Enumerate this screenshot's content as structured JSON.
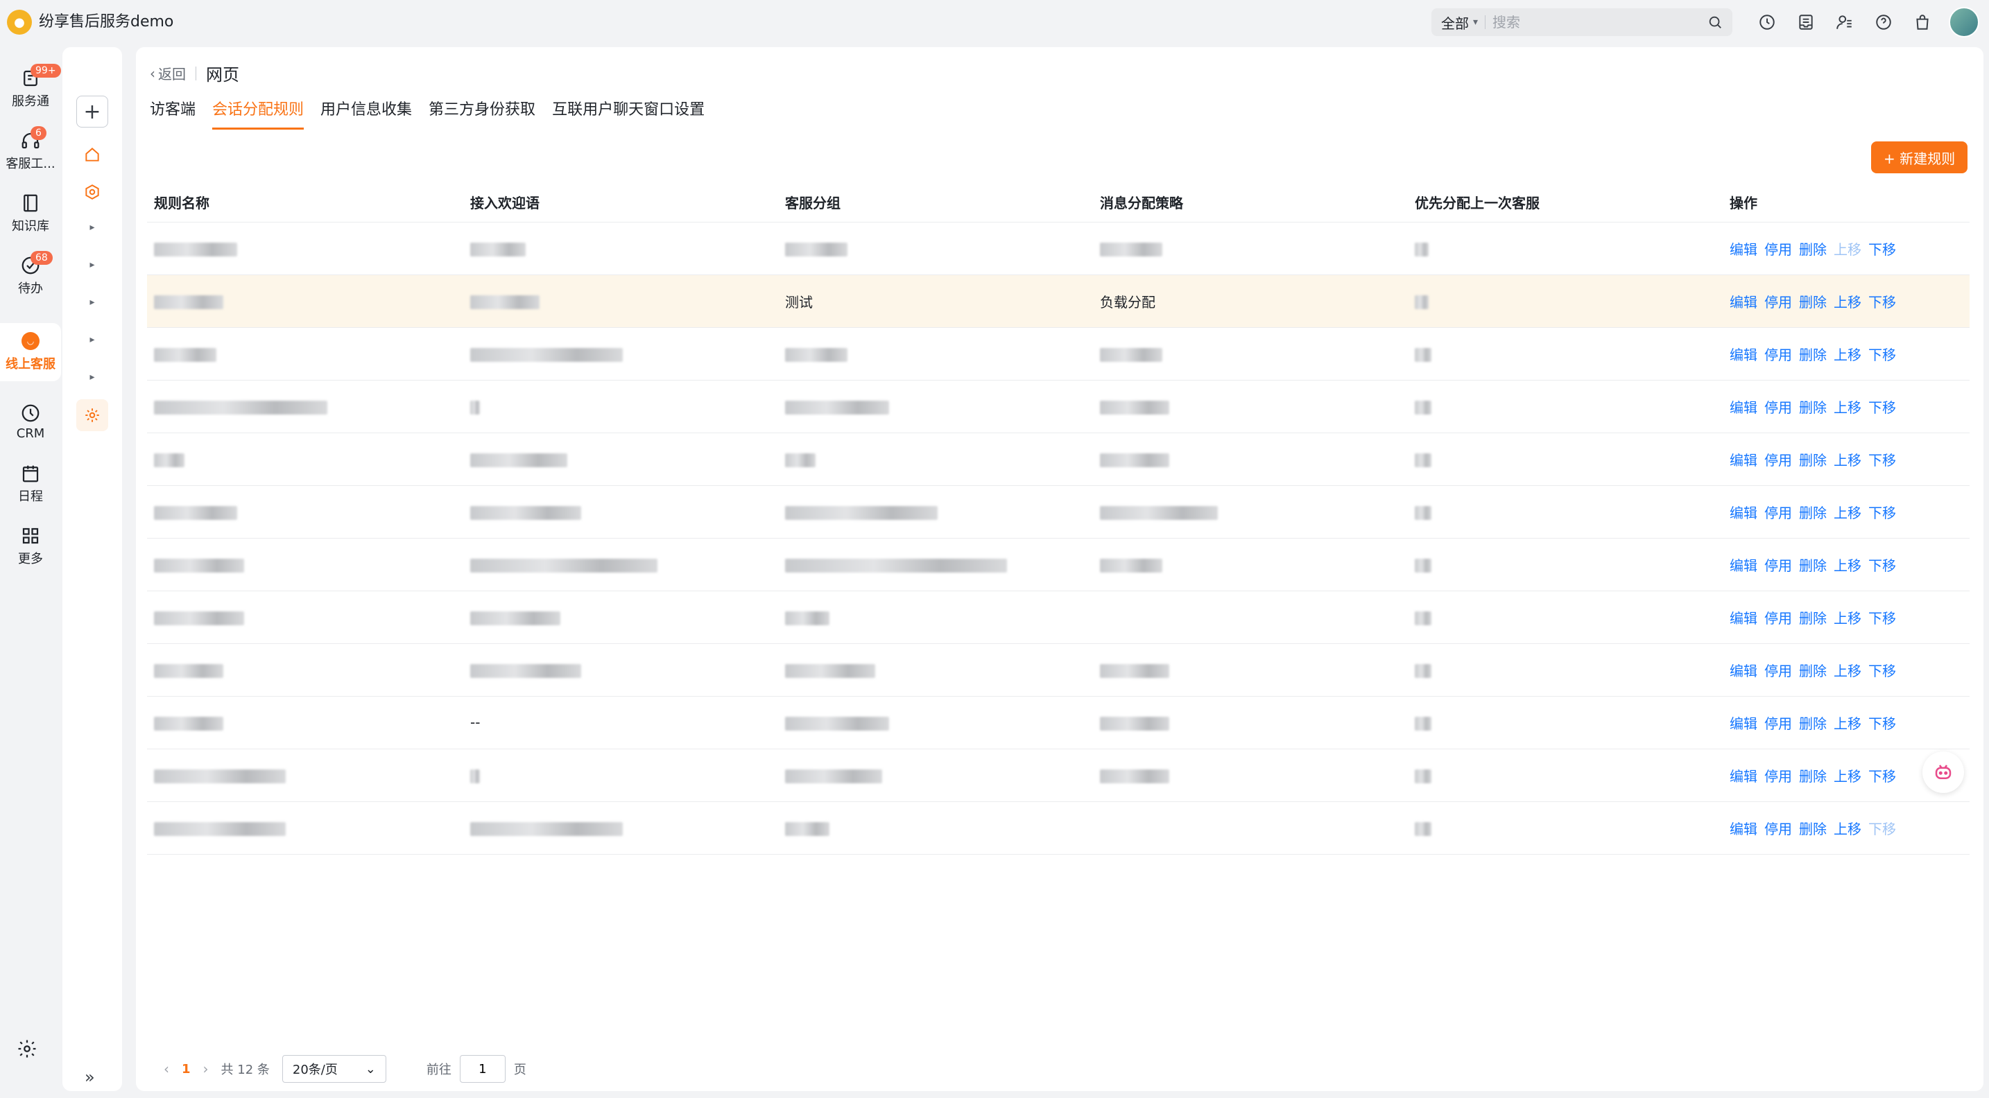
{
  "app": {
    "title": "纷享售后服务demo",
    "logo_icon": "bee-logo-icon"
  },
  "search": {
    "scope": "全部",
    "placeholder": "搜索"
  },
  "top_icons": [
    "clock-icon",
    "inbox-icon",
    "user-settings-icon",
    "help-icon",
    "bag-icon"
  ],
  "leftnav": [
    {
      "label": "服务通",
      "badge": "99+",
      "icon": "service-icon"
    },
    {
      "label": "客服工...",
      "badge": "6",
      "icon": "headset-icon"
    },
    {
      "label": "知识库",
      "badge": "",
      "icon": "book-icon"
    },
    {
      "label": "待办",
      "badge": "68",
      "icon": "check-icon"
    },
    {
      "label": "线上客服",
      "badge": "",
      "icon": "chat-icon",
      "active": true
    },
    {
      "label": "CRM",
      "badge": "",
      "icon": "crm-icon"
    },
    {
      "label": "日程",
      "badge": "",
      "icon": "calendar-icon"
    },
    {
      "label": "更多",
      "badge": "",
      "icon": "grid-icon"
    }
  ],
  "main": {
    "back_label": "返回",
    "page_title": "网页",
    "tabs": [
      {
        "label": "访客端",
        "active": false
      },
      {
        "label": "会话分配规则",
        "active": true
      },
      {
        "label": "用户信息收集",
        "active": false
      },
      {
        "label": "第三方身份获取",
        "active": false
      },
      {
        "label": "互联用户聊天窗口设置",
        "active": false
      }
    ],
    "new_rule_label": "+ 新建规则",
    "columns": [
      "规则名称",
      "接入欢迎语",
      "客服分组",
      "消息分配策略",
      "优先分配上一次客服",
      "操作"
    ],
    "ops": [
      "编辑",
      "停用",
      "删除",
      "上移",
      "下移"
    ],
    "rows": [
      {
        "group": "",
        "strategy": "",
        "welcome": ""
      },
      {
        "group": "测试",
        "strategy": "负载分配",
        "welcome": ""
      },
      {
        "group": "",
        "strategy": "",
        "welcome": ""
      },
      {
        "group": "",
        "strategy": "",
        "welcome": ""
      },
      {
        "group": "",
        "strategy": "",
        "welcome": ""
      },
      {
        "group": "",
        "strategy": "",
        "welcome": ""
      },
      {
        "group": "",
        "strategy": "",
        "welcome": ""
      },
      {
        "group": "",
        "strategy": "",
        "welcome": ""
      },
      {
        "group": "",
        "strategy": "",
        "welcome": ""
      },
      {
        "group": "",
        "strategy": "",
        "welcome": "--"
      },
      {
        "group": "",
        "strategy": "",
        "welcome": ""
      },
      {
        "group": "",
        "strategy": "",
        "welcome": ""
      }
    ]
  },
  "pagination": {
    "current_page": "1",
    "total": "共 12 条",
    "page_size": "20条/页",
    "goto_prefix": "前往",
    "goto_value": "1",
    "goto_suffix": "页"
  },
  "colors": {
    "accent": "#f97316",
    "link": "#1677ff",
    "highlight_row": "#fdf6e9"
  }
}
